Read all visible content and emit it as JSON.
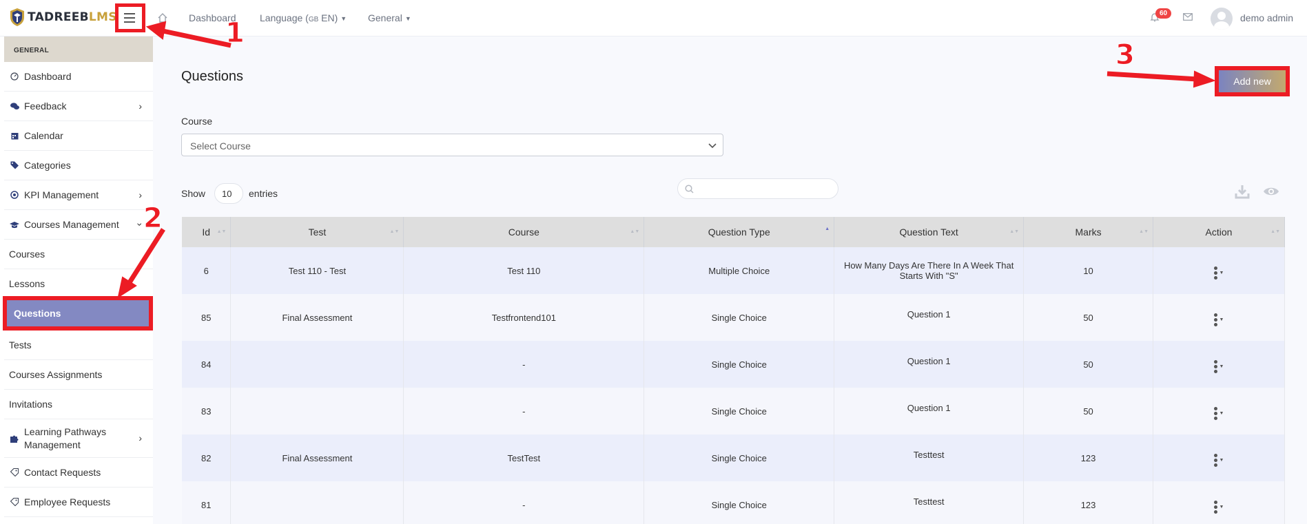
{
  "header": {
    "logo_text_main": "TADREEB",
    "logo_text_accent": "LMS",
    "nav": {
      "dashboard": "Dashboard",
      "language": "Language (",
      "language_code": "GB",
      "language_value": " EN)",
      "general": "General"
    },
    "notification_count": "60",
    "user_name": "demo admin"
  },
  "sidebar": {
    "section_title": "GENERAL",
    "items": [
      {
        "label": "Dashboard"
      },
      {
        "label": "Feedback"
      },
      {
        "label": "Calendar"
      },
      {
        "label": "Categories"
      },
      {
        "label": "KPI Management"
      },
      {
        "label": "Courses Management"
      },
      {
        "label": "Courses"
      },
      {
        "label": "Lessons"
      },
      {
        "label": "Questions"
      },
      {
        "label": "Tests"
      },
      {
        "label": "Courses Assignments"
      },
      {
        "label": "Invitations"
      },
      {
        "label": "Learning Pathways Management"
      },
      {
        "label": "Contact Requests"
      },
      {
        "label": "Employee Requests"
      }
    ]
  },
  "main": {
    "title": "Questions",
    "add_button": "Add new",
    "course_label": "Course",
    "course_select_value": "Select Course",
    "show_label": "Show",
    "entries_value": "10",
    "entries_label": "entries",
    "search_placeholder": ""
  },
  "table": {
    "columns": [
      "Id",
      "Test",
      "Course",
      "Question Type",
      "Question Text",
      "Marks",
      "Action"
    ],
    "rows": [
      {
        "id": "6",
        "test": "Test 110 - Test",
        "course": "Test 110",
        "type": "Multiple Choice",
        "text": "How Many Days Are There In A Week That Starts With \"S\"",
        "marks": "10"
      },
      {
        "id": "85",
        "test": "Final Assessment",
        "course": "Testfrontend101",
        "type": "Single Choice",
        "text": "Question 1",
        "marks": "50"
      },
      {
        "id": "84",
        "test": "",
        "course": "-",
        "type": "Single Choice",
        "text": "Question 1",
        "marks": "50"
      },
      {
        "id": "83",
        "test": "",
        "course": "-",
        "type": "Single Choice",
        "text": "Question 1",
        "marks": "50"
      },
      {
        "id": "82",
        "test": "Final Assessment",
        "course": "TestTest",
        "type": "Single Choice",
        "text": "Testtest",
        "marks": "123"
      },
      {
        "id": "81",
        "test": "",
        "course": "-",
        "type": "Single Choice",
        "text": "Testtest",
        "marks": "123"
      }
    ]
  },
  "annotations": {
    "step1": "1",
    "step2": "2",
    "step3": "3",
    "color": "#ec1c24"
  },
  "colors": {
    "active_item": "#8389c2",
    "accent_gold": "#c8a13b",
    "badge": "#ef4444"
  }
}
